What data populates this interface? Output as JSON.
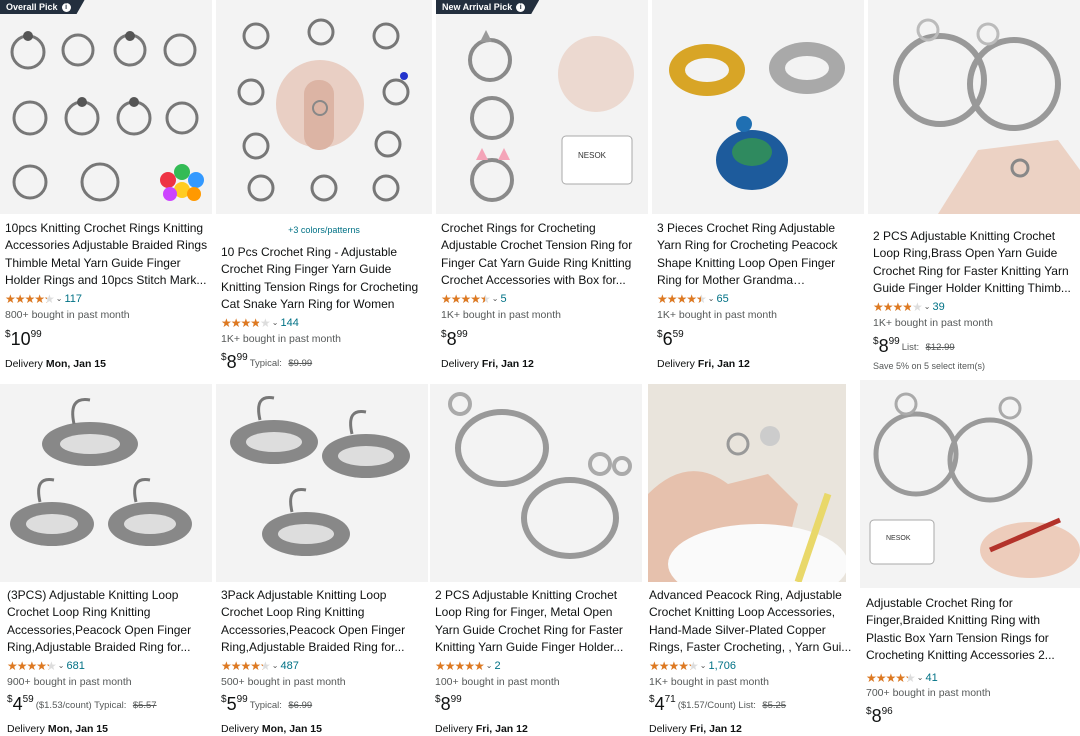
{
  "products": [
    {
      "badge": "Overall Pick",
      "variants": "",
      "title": "10pcs Knitting Crochet Rings Knitting Accessories Adjustable Braided Rings Thimble Metal Yarn Guide Finger Holder Rings and 10pcs Stitch Mark...",
      "rating": 4.3,
      "reviews": "117",
      "bought": "800+ bought in past month",
      "price_whole": "10",
      "price_frac": "99",
      "price_extra": "",
      "save": "",
      "delivery_label": "Delivery",
      "delivery_date": "Mon, Jan 15"
    },
    {
      "badge": "",
      "variants": "+3 colors/patterns",
      "title": "10 Pcs Crochet Ring - Adjustable Crochet Ring Finger Yarn Guide Knitting Tension Rings for Crocheting Cat Snake Yarn Ring for Women",
      "rating": 4.0,
      "reviews": "144",
      "bought": "1K+ bought in past month",
      "price_whole": "8",
      "price_frac": "99",
      "price_extra": "Typical:",
      "price_strike": "$9.99",
      "save": "",
      "delivery_label": "",
      "delivery_date": ""
    },
    {
      "badge": "New Arrival Pick",
      "variants": "",
      "title": "Crochet Rings for Crocheting Adjustable Crochet Tension Ring for Finger Cat Yarn Guide Ring Knitting Crochet Accessories with Box for...",
      "rating": 4.5,
      "reviews": "5",
      "bought": "1K+ bought in past month",
      "price_whole": "8",
      "price_frac": "99",
      "price_extra": "",
      "save": "",
      "delivery_label": "Delivery",
      "delivery_date": "Fri, Jan 12"
    },
    {
      "badge": "",
      "variants": "",
      "title": "3 Pieces Crochet Ring Adjustable Yarn Ring for Crocheting Peacock Shape Knitting Loop Open Finger Ring for Mother Grandma Thanksgiving...",
      "rating": 4.5,
      "reviews": "65",
      "bought": "1K+ bought in past month",
      "price_whole": "6",
      "price_frac": "59",
      "price_extra": "",
      "save": "",
      "delivery_label": "Delivery",
      "delivery_date": "Fri, Jan 12"
    },
    {
      "badge": "",
      "variants": "",
      "title": "2 PCS Adjustable Knitting Crochet Loop Ring,Brass Open Yarn Guide Crochet Ring for Faster Knitting Yarn Guide Finger Holder Knitting Thimb...",
      "rating": 4.0,
      "reviews": "39",
      "bought": "1K+ bought in past month",
      "price_whole": "8",
      "price_frac": "99",
      "price_extra": "List:",
      "price_strike": "$12.99",
      "save": "Save 5% on 5 select item(s)",
      "delivery_label": "",
      "delivery_date": ""
    },
    {
      "badge": "",
      "variants": "",
      "title": "(3PCS) Adjustable Knitting Loop Crochet Loop Ring Knitting Accessories,Peacock Open Finger Ring,Adjustable Braided Ring for...",
      "rating": 4.3,
      "reviews": "681",
      "bought": "900+ bought in past month",
      "price_whole": "4",
      "price_frac": "59",
      "price_extra": "($1.53/count) Typical:",
      "price_strike": "$5.57",
      "save": "",
      "delivery_label": "Delivery",
      "delivery_date": "Mon, Jan 15"
    },
    {
      "badge": "",
      "variants": "",
      "title": "3Pack Adjustable Knitting Loop Crochet Loop Ring Knitting Accessories,Peacock Open Finger Ring,Adjustable Braided Ring for...",
      "rating": 4.3,
      "reviews": "487",
      "bought": "500+ bought in past month",
      "price_whole": "5",
      "price_frac": "99",
      "price_extra": "Typical:",
      "price_strike": "$6.99",
      "save": "",
      "delivery_label": "Delivery",
      "delivery_date": "Mon, Jan 15"
    },
    {
      "badge": "",
      "variants": "",
      "title": "2 PCS Adjustable Knitting Crochet Loop Ring for Finger, Metal Open Yarn Guide Crochet Ring for Faster Knitting Yarn Guide Finger Holder...",
      "rating": 5.0,
      "reviews": "2",
      "bought": "100+ bought in past month",
      "price_whole": "8",
      "price_frac": "99",
      "price_extra": "",
      "save": "",
      "delivery_label": "Delivery",
      "delivery_date": "Fri, Jan 12"
    },
    {
      "badge": "",
      "variants": "",
      "title": "Advanced Peacock Ring, Adjustable Crochet Knitting Loop Accessories, Hand-Made Silver-Plated Copper Rings, Faster Crocheting, , Yarn Gui...",
      "rating": 4.3,
      "reviews": "1,706",
      "bought": "1K+ bought in past month",
      "price_whole": "4",
      "price_frac": "71",
      "price_extra": "($1.57/Count) List:",
      "price_strike": "$5.25",
      "save": "",
      "delivery_label": "Delivery",
      "delivery_date": "Fri, Jan 12"
    },
    {
      "badge": "",
      "variants": "",
      "title": "Adjustable Crochet Ring for Finger,Braided Knitting Ring with Plastic Box Yarn Tension Rings for Crocheting Knitting Accessories 2...",
      "rating": 4.3,
      "reviews": "41",
      "bought": "700+ bought in past month",
      "price_whole": "8",
      "price_frac": "96",
      "price_extra": "",
      "save": "",
      "delivery_label": "",
      "delivery_date": ""
    }
  ],
  "currency": "$",
  "star_glyphs": "★★★★★",
  "chevron": "⌄",
  "colors": {
    "link": "#007185",
    "star": "#de7921",
    "badge": "#232f3e",
    "image_bg": "#f3f3f3"
  }
}
